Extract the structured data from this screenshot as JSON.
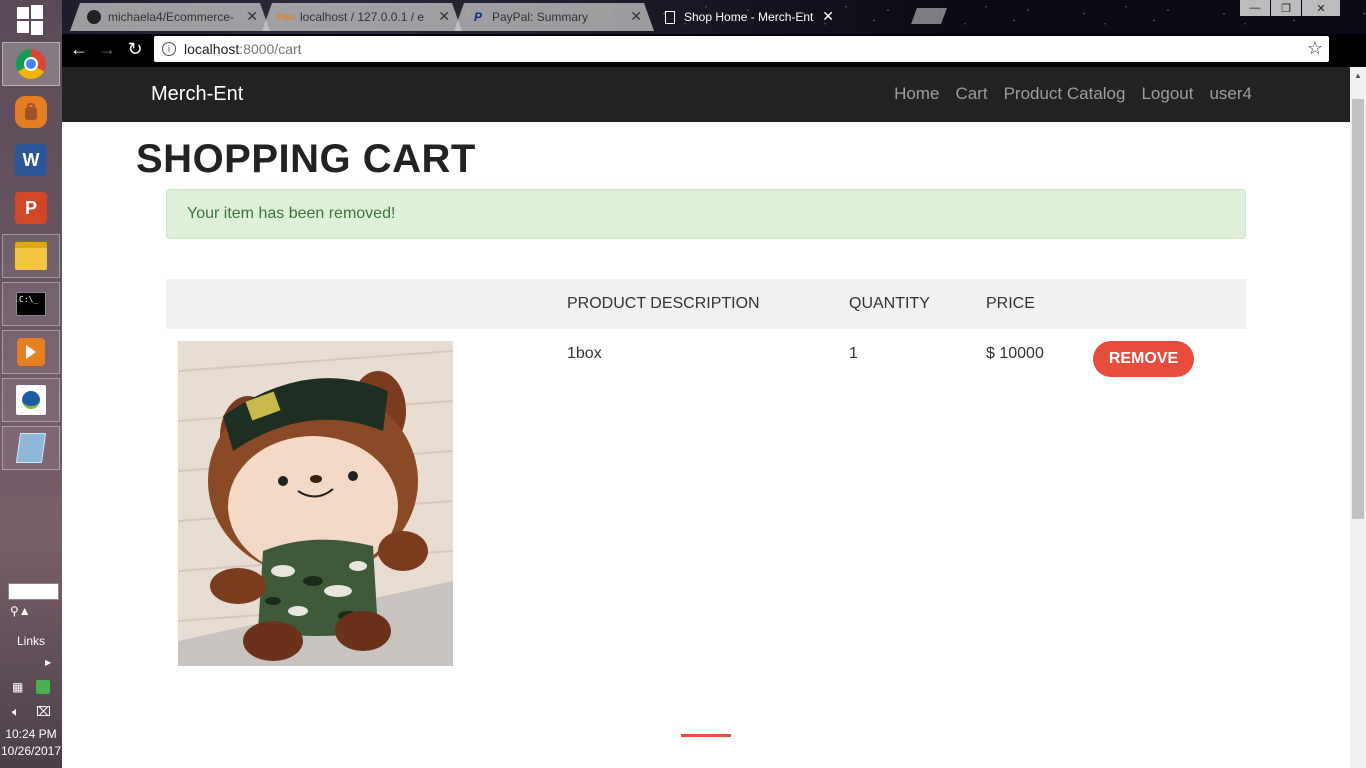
{
  "taskbar": {
    "apps": [
      {
        "icon": "chrome-icon",
        "color": "#4285f4"
      },
      {
        "icon": "backpack-icon",
        "color": "#e67e22"
      },
      {
        "icon": "word-icon",
        "color": "#2b579a",
        "letter": "W"
      },
      {
        "icon": "powerpoint-icon",
        "color": "#d24726",
        "letter": "P"
      },
      {
        "icon": "file-explorer-icon",
        "color": "#f4c542"
      },
      {
        "icon": "command-prompt-icon",
        "color": "#000000"
      },
      {
        "icon": "media-player-icon",
        "color": "#e67e22"
      },
      {
        "icon": "globe-broadband-icon",
        "color": "#1e5aa8"
      },
      {
        "icon": "notepad-icon",
        "color": "#8fb8d8"
      }
    ],
    "links_label": "Links",
    "time": "10:24 PM",
    "date": "10/26/2017"
  },
  "browser": {
    "tabs": [
      {
        "title": "michaela4/Ecommerce-",
        "icon": "github-icon",
        "active": false
      },
      {
        "title": "localhost / 127.0.0.1 / e",
        "icon": "phpmyadmin-icon",
        "active": false
      },
      {
        "title": "PayPal: Summary",
        "icon": "paypal-icon",
        "active": false
      },
      {
        "title": "Shop Home - Merch-Ent",
        "icon": "document-icon",
        "active": true
      }
    ],
    "url_host": "localhost",
    "url_path": ":8000/cart"
  },
  "site": {
    "brand": "Merch-Ent",
    "nav": [
      "Home",
      "Cart",
      "Product Catalog",
      "Logout",
      "user4"
    ]
  },
  "page": {
    "title": "SHOPPING CART",
    "alert": "Your item has been removed!",
    "table": {
      "headers": [
        "PRODUCT DESCRIPTION",
        "QUANTITY",
        "PRICE"
      ],
      "rows": [
        {
          "description": "1box",
          "quantity": "1",
          "price": "$ 10000",
          "action": "REMOVE"
        }
      ]
    }
  },
  "colors": {
    "navbar": "#222222",
    "accent": "#e74c3c",
    "alert_bg": "#dff0d8",
    "alert_text": "#3c763d"
  }
}
